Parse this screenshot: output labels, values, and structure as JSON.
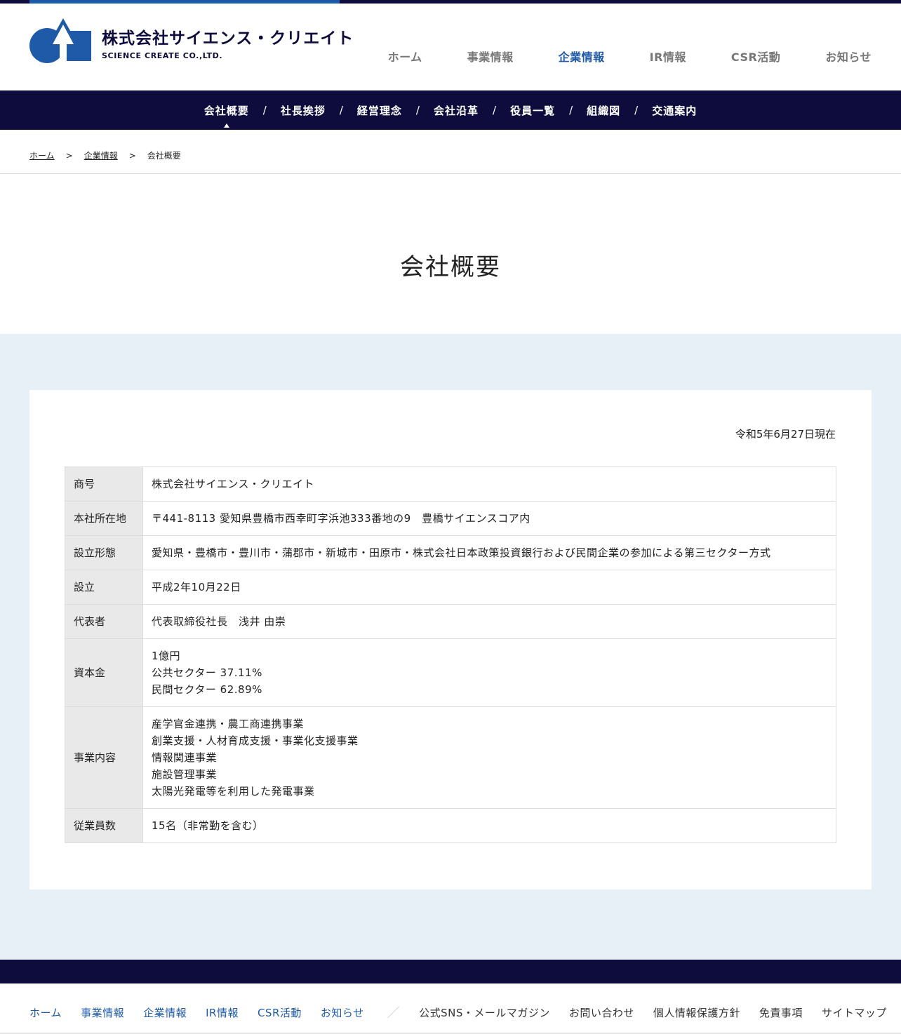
{
  "brand": {
    "name_jp": "株式会社サイエンス・クリエイト",
    "name_en": "SCIENCE CREATE CO.,LTD.",
    "color_navy": "#0d0c3d",
    "color_blue": "#1e5aa8"
  },
  "global_nav": [
    {
      "label": "ホーム",
      "active": false
    },
    {
      "label": "事業情報",
      "active": false
    },
    {
      "label": "企業情報",
      "active": true
    },
    {
      "label": "IR情報",
      "active": false
    },
    {
      "label": "CSR活動",
      "active": false
    },
    {
      "label": "お知らせ",
      "active": false
    }
  ],
  "sub_nav": [
    {
      "label": "会社概要",
      "active": true
    },
    {
      "label": "社長挨拶",
      "active": false
    },
    {
      "label": "経営理念",
      "active": false
    },
    {
      "label": "会社沿革",
      "active": false
    },
    {
      "label": "役員一覧",
      "active": false
    },
    {
      "label": "組織図",
      "active": false
    },
    {
      "label": "交通案内",
      "active": false
    }
  ],
  "sub_nav_separator": "/",
  "breadcrumb": {
    "items": [
      "ホーム",
      "企業情報",
      "会社概要"
    ],
    "separator": ">"
  },
  "page_title": "会社概要",
  "as_of": "令和5年6月27日現在",
  "company_table": [
    {
      "label": "商号",
      "lines": [
        "株式会社サイエンス・クリエイト"
      ]
    },
    {
      "label": "本社所在地",
      "lines": [
        "〒441-8113 愛知県豊橋市西幸町字浜池333番地の9　豊橋サイエンスコア内"
      ]
    },
    {
      "label": "設立形態",
      "lines": [
        "愛知県・豊橋市・豊川市・蒲郡市・新城市・田原市・株式会社日本政策投資銀行および民間企業の参加による第三セクター方式"
      ]
    },
    {
      "label": "設立",
      "lines": [
        "平成2年10月22日"
      ]
    },
    {
      "label": "代表者",
      "lines": [
        "代表取締役社長　浅井 由崇"
      ]
    },
    {
      "label": "資本金",
      "lines": [
        "1億円",
        "公共セクター 37.11%",
        "民間セクター 62.89%"
      ]
    },
    {
      "label": "事業内容",
      "lines": [
        "産学官金連携・農工商連携事業",
        "創業支援・人材育成支援・事業化支援事業",
        "情報関連事業",
        "施設管理事業",
        "太陽光発電等を利用した発電事業"
      ]
    },
    {
      "label": "従業員数",
      "lines": [
        "15名（非常勤を含む）"
      ]
    }
  ],
  "footer": {
    "main_links": [
      "ホーム",
      "事業情報",
      "企業情報",
      "IR情報",
      "CSR活動",
      "お知らせ"
    ],
    "divider": "／",
    "sub_links": [
      "公式SNS・メールマガジン",
      "お問い合わせ",
      "個人情報保護方針",
      "免責事項",
      "サイトマップ"
    ]
  }
}
